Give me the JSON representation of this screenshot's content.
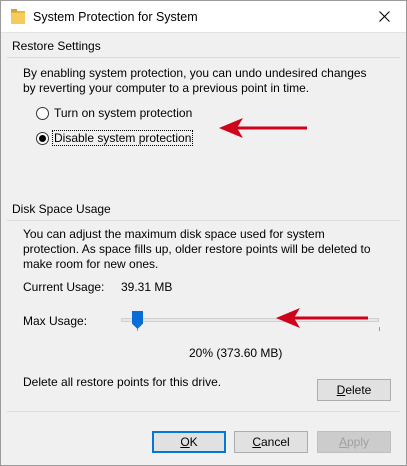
{
  "window": {
    "title": "System Protection for System",
    "icons": {
      "title": "folder-icon",
      "close": "close-icon"
    }
  },
  "restore_settings": {
    "heading": "Restore Settings",
    "description": "By enabling system protection, you can undo undesired changes by reverting your computer to a previous point in time.",
    "options": [
      {
        "label": "Turn on system protection",
        "selected": false
      },
      {
        "label": "Disable system protection",
        "selected": true
      }
    ]
  },
  "disk_space": {
    "heading": "Disk Space Usage",
    "description": "You can adjust the maximum disk space used for system protection. As space fills up, older restore points will be deleted to make room for new ones.",
    "current_usage_label": "Current Usage:",
    "current_usage_value": "39.31 MB",
    "max_usage_label": "Max Usage:",
    "max_usage_value": "20% (373.60 MB)",
    "max_usage_fraction": 0.05,
    "delete_text": "Delete all restore points for this drive.",
    "delete_button": {
      "label": "Delete",
      "accel": "D",
      "rest": "elete"
    }
  },
  "footer": {
    "ok": {
      "label": "OK",
      "accel": "O",
      "rest": "K"
    },
    "cancel": {
      "label": "Cancel",
      "accel": "C",
      "rest": "ancel"
    },
    "apply": {
      "label": "Apply",
      "accel": "A",
      "rest": "pply",
      "enabled": false
    }
  },
  "colors": {
    "accent": "#0078d7",
    "annotation_arrow": "#d0021b",
    "window_bg": "#f0f0f0"
  }
}
